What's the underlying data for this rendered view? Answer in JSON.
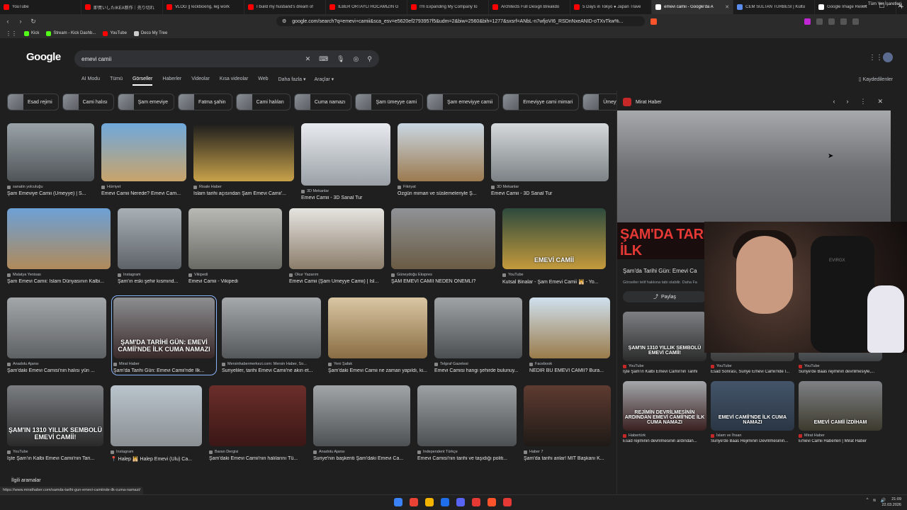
{
  "browser": {
    "tabs": [
      {
        "title": "YouTube",
        "color": "#ff0000",
        "active": false
      },
      {
        "title": "即買いしたIKEA新作｜売り切れ",
        "color": "#ff0000",
        "active": false
      },
      {
        "title": "VLOG || kickboxing, leg work",
        "color": "#ff0000",
        "active": false
      },
      {
        "title": "I build my husband's dream of",
        "color": "#ff0000",
        "active": false
      },
      {
        "title": "İLBER ORTAYLI HOCAMIZIN G",
        "color": "#ff0000",
        "active": false
      },
      {
        "title": "I'm Expanding My Company to",
        "color": "#ff0000",
        "active": false
      },
      {
        "title": "Architects Full Design Breakdo",
        "color": "#ff0000",
        "active": false
      },
      {
        "title": "5 Days in Tokyo ● Japan Trave",
        "color": "#ff0000",
        "active": false
      },
      {
        "title": "emevi camii - Google'da A",
        "color": "#ffffff",
        "active": true
      },
      {
        "title": "CEM SULTAN TÜRBESİ | Kültü",
        "color": "#5a8dee",
        "active": false
      },
      {
        "title": "Google Image Result",
        "color": "#ffffff",
        "active": false
      }
    ],
    "new_tab": "+",
    "url": "google.com/search?q=emevi+camii&sca_esv=e5620ef2793957f5&udm=2&biw=2560&bih=1277&sxsrf=ANbL-n7wfjoVI6_RSDnNxeANID-oTXvTkw%...",
    "bookmarks": [
      {
        "label": "Kick",
        "color": "#53fc18"
      },
      {
        "label": "Stream - Kick Dashb...",
        "color": "#53fc18"
      },
      {
        "label": "YouTube",
        "color": "#ff0000"
      },
      {
        "label": "Deco My Tree",
        "color": "#cccccc"
      }
    ],
    "bookmarks_right": "Tüm Yer İşaretleri"
  },
  "google": {
    "logo": "Google",
    "query": "emevi camii",
    "tabs": [
      "AI Modu",
      "Tümü",
      "Görseller",
      "Haberler",
      "Videolar",
      "Kısa videolar",
      "Web",
      "Daha fazla ▾",
      "Araçlar ▾"
    ],
    "active_tab": "Görseller",
    "saved": "Kaydedilenler",
    "chips": [
      "Esad rejimi",
      "Cami halısı",
      "Şam emeviye",
      "Fatma şahin",
      "Cami halıları",
      "Cuma namazı",
      "Şam ümeyye cami",
      "Şam emeviyye camii",
      "Emeviyye cami mimari",
      "Ümeyye cam"
    ],
    "related_searches": "İlgili aramalar"
  },
  "results": [
    [
      {
        "source": "sanatin yolculuğu",
        "title": "Şam Emeviye Camii (Ümeyye) | S...",
        "w": 123,
        "h": 82,
        "c1": "#9aa3a8",
        "c2": "#4f5458"
      },
      {
        "source": "Hürriyet",
        "title": "Emevi Camii Nerede? Emevi Cam...",
        "w": 120,
        "h": 82,
        "c1": "#6fa8dc",
        "c2": "#c9a46a"
      },
      {
        "source": "Risale Haber",
        "title": "İslam tarihi açısından Şam Emevi Camii'...",
        "w": 142,
        "h": 82,
        "c1": "#1c1c1c",
        "c2": "#c8a24a"
      },
      {
        "source": "3D Mekanlar",
        "title": "Emevi Camii - 3D Sanal Tur",
        "w": 126,
        "h": 88,
        "c1": "#e8ebef",
        "c2": "#9aa0a6"
      },
      {
        "source": "Fikriyat",
        "title": "Özgün mimari ve süslemeleriyle Ş...",
        "w": 122,
        "h": 82,
        "c1": "#c9d7e3",
        "c2": "#9c7a4f"
      },
      {
        "source": "3D Mekanlar",
        "title": "Emevi Camii - 3D Sanal Tur",
        "w": 166,
        "h": 82,
        "c1": "#d5d9dc",
        "c2": "#7c8285"
      }
    ],
    [
      {
        "source": "Malatya Yenisas",
        "title": "Şam Emevi Camii: İslam Dünyasının Kalbi...",
        "w": 146,
        "h": 86,
        "c1": "#6ca0d6",
        "c2": "#b08a5a"
      },
      {
        "source": "Instagram",
        "title": "Şam'ın eski şehir kısmınd...",
        "w": 90,
        "h": 86,
        "c1": "#a9b0b5",
        "c2": "#5d6368"
      },
      {
        "source": "Vikipedi",
        "title": "Emevi Camii - Vikipedi",
        "w": 132,
        "h": 86,
        "c1": "#b8b8b4",
        "c2": "#6b6b66"
      },
      {
        "source": "Okur Yazarım",
        "title": "Emevi Camii (Şam Ümeyye Camii) | İsl...",
        "w": 134,
        "h": 86,
        "c1": "#e6e4e1",
        "c2": "#8b7d6a"
      },
      {
        "source": "Güneydoğu Ekspres",
        "title": "ŞAM EMEVİ CAMİİ NEDEN ÖNEMLİ?",
        "w": 147,
        "h": 86,
        "c1": "#8f9296",
        "c2": "#6a5b44"
      },
      {
        "source": "YouTube",
        "title": "Kutsal Binalar - Şam Emevi Camii 🕌 - Yo...",
        "w": 146,
        "h": 86,
        "c1": "#2d4a3d",
        "c2": "#c49a3c",
        "overlay": "EMEVİ CAMİİ"
      }
    ],
    [
      {
        "source": "Anadolu Ajansı",
        "title": "Şam'daki Emevi Camisi'nin halısı yün ...",
        "w": 140,
        "h": 86,
        "c1": "#a4a7aa",
        "c2": "#5e6164"
      },
      {
        "source": "Mirat Haber",
        "title": "Şam'da Tarihi Gün: Emevi Camii'nde İlk...",
        "w": 143,
        "h": 86,
        "c1": "#8c8e91",
        "c2": "#3a2a2a",
        "overlay": "ŞAM'DA TARİHİ GÜN: EMEVİ CAMİİ'NDE İLK CUMA NAMAZI",
        "selected": true
      },
      {
        "source": "Mersinhabermerkezi.com: Mersin Haber, So...",
        "title": "Suriyeliler, tarihi Emevi Camii'ne akın et...",
        "w": 140,
        "h": 86,
        "c1": "#a6a9ac",
        "c2": "#55585b"
      },
      {
        "source": "Yeni Şafak",
        "title": "Şam'daki Emevi Camii ne zaman yapıldı, ki...",
        "w": 140,
        "h": 86,
        "c1": "#d9c6a3",
        "c2": "#8a6d43"
      },
      {
        "source": "Telgraf Gazetesi",
        "title": "Emevi Camisi hangi şehirde bulunuy...",
        "w": 124,
        "h": 86,
        "c1": "#9fa3a6",
        "c2": "#4b4f52"
      },
      {
        "source": "Facebook",
        "title": "NEDİR BU EMEVİ CAMİİ? Bura...",
        "w": 114,
        "h": 86,
        "c1": "#cfe0ee",
        "c2": "#9a7b4a"
      }
    ],
    [
      {
        "source": "YouTube",
        "title": "İşte Şam'ın Kalbi Emevi Camii'nin Tari...",
        "w": 136,
        "h": 86,
        "c1": "#7b7e82",
        "c2": "#2a2a2a",
        "overlay": "ŞAM'IN 1310 YILLIK SEMBOLÜ EMEVİ CAMİİ!"
      },
      {
        "source": "Instagram",
        "title": "📍 Halep 🕌 Halep Emevi (Ulu) Ca...",
        "w": 129,
        "h": 86,
        "c1": "#b9c4cc",
        "c2": "#8a8f93"
      },
      {
        "source": "Baran Dergisi",
        "title": "Şam'daki Emevi Camii'nin halılarını Tü...",
        "w": 137,
        "h": 86,
        "c1": "#6b2e2a",
        "c2": "#3a1715"
      },
      {
        "source": "Anadolu Ajansı",
        "title": "Suriye'nin başkenti Şam'daki Emevi Ca...",
        "w": 137,
        "h": 86,
        "c1": "#a2a5a8",
        "c2": "#4e5154"
      },
      {
        "source": "Independent Türkçe",
        "title": "Emevi Camisi'nin tarihi ve taşıdığı politi...",
        "w": 140,
        "h": 86,
        "c1": "#9da1a4",
        "c2": "#4d5053"
      },
      {
        "source": "Haber 7",
        "title": "Şam'da tarihi anlar! MİT Başkanı K...",
        "w": 123,
        "h": 86,
        "c1": "#5e3b30",
        "c2": "#1f1a17"
      }
    ]
  ],
  "panel": {
    "source": "Mirat Haber",
    "banner": "ŞAM'DA TARİHİ GÜN: EMEVİ CAMİİ'NDE İLK",
    "title": "Şam'da Tarihi Gün: Emevi Ca",
    "subtitle": "Görseller telif hakkına tabi olabilir. Daha Fa",
    "share": "Paylaş",
    "related": [
      {
        "source": "YouTube",
        "title": "İşte Şam'ın Kalbi Emevi Camii'nin Tarihi",
        "c1": "#7d8083",
        "c2": "#2b2b2b",
        "overlay": "ŞAM'IN 1310 YILLIK SEMBOLÜ EMEVİ CAMİİ!"
      },
      {
        "source": "YouTube",
        "title": "Esad Sonrası, Suriye Emevi Camii'nde İ...",
        "c1": "#8a8d90",
        "c2": "#3a3a3a"
      },
      {
        "source": "YouTube",
        "title": "Suriye'de Baas rejiminin devrilmesiyle,...",
        "c1": "#9a9da0",
        "c2": "#404346"
      },
      {
        "source": "Habertürk",
        "title": "Esad rejiminin devrilmesinin ardından...",
        "c1": "#a4a7aa",
        "c2": "#3a2020",
        "overlay": "REJİMİN DEVRİLMESİNİN ARDINDAN EMEVİ CAMİİ'NDE İLK CUMA NAMAZI"
      },
      {
        "source": "İslam ve İhsan",
        "title": "Suriye'de Baas Rejiminin Devrilmesinin...",
        "c1": "#44556a",
        "c2": "#2a3644",
        "overlay": "EMEVİ CAMİİ'NDE İLK CUMA NAMAZI"
      },
      {
        "source": "Mirat Haber",
        "title": "Emevi Camii Haberleri | Mirat Haber",
        "c1": "#7e8184",
        "c2": "#3d3a2e",
        "overlay": "EMEVİ CAMİİ İZDİHAM"
      }
    ]
  },
  "status_url": "https://www.mirathaber.com/samda-tarihi-gun-emevi-camiinde-ilk-cuma-namazi/",
  "taskbar": {
    "icons": [
      "#3b82f6",
      "#ea4335",
      "#f4b400",
      "#1f6feb",
      "#5865f2",
      "#e53935",
      "#fb542b",
      "#e53935"
    ],
    "time": "21:09",
    "date": "22.03.2026"
  }
}
